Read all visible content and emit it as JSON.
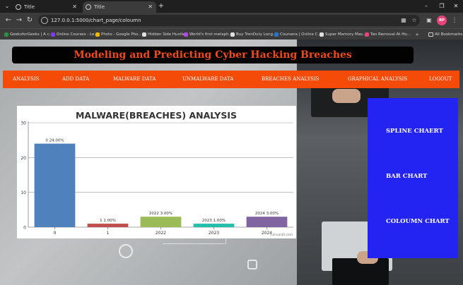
{
  "browser": {
    "tabs": [
      {
        "title": "Title",
        "active": false
      },
      {
        "title": "Title",
        "active": true
      }
    ],
    "url": "127.0.0.1:5000/chart_page/coloumn",
    "profile_initials": "RP",
    "bookmarks": [
      {
        "label": "GeeksforGeeks | A c...",
        "color": "#2f8d46"
      },
      {
        "label": "Online Courses - Le...",
        "color": "#7b3fe4"
      },
      {
        "label": "Photo - Google Pho...",
        "color": "#f4b400"
      },
      {
        "label": "Hidden Side Hustle",
        "color": "#e0e0e0"
      },
      {
        "label": "World's first metaph...",
        "color": "#b04ae0"
      },
      {
        "label": "Buy TrenDuty Long...",
        "color": "#e0e0e0"
      },
      {
        "label": "Coursera | Online C...",
        "color": "#2a73cc"
      },
      {
        "label": "Super Memory Mas...",
        "color": "#e0e0e0"
      },
      {
        "label": "Tan Removal At Ho...",
        "color": "#e8447c"
      }
    ],
    "all_bookmarks": "All Bookmarks"
  },
  "app": {
    "title": "Modeling and Predicting Cyber Hacking Breaches",
    "nav": [
      "ANALYSIS",
      "ADD DATA",
      "MALWARE DATA",
      "UNMALWARE DATA",
      "BREACHES ANALYSIS",
      "GRAPHICAL ANALYSIS",
      "LOGOUT"
    ],
    "side_links": [
      "SPLINE CHAERT",
      "BAR CHART",
      "COLOUMN CHART"
    ],
    "colors": {
      "nav": "#f44b09",
      "title_text": "#f04a1c",
      "side_panel": "#2323f2"
    }
  },
  "chart_data": {
    "type": "bar",
    "title": "MALWARE(BREACHES) ANALYSIS",
    "categories": [
      "0",
      "1",
      "2022",
      "2023",
      "2024"
    ],
    "values": [
      24,
      1,
      3,
      1,
      3
    ],
    "labels": [
      "0 24.00%",
      "1 1.00%",
      "2022 3.00%",
      "2023 1.00%",
      "2024 3.00%"
    ],
    "colors": [
      "#4f81bc",
      "#c0504e",
      "#9bbb58",
      "#23bfaa",
      "#8064a1"
    ],
    "ylim": [
      0,
      30
    ],
    "yticks": [
      0,
      10,
      20,
      30
    ],
    "grid": true,
    "credit": "CanvasJS.com"
  }
}
